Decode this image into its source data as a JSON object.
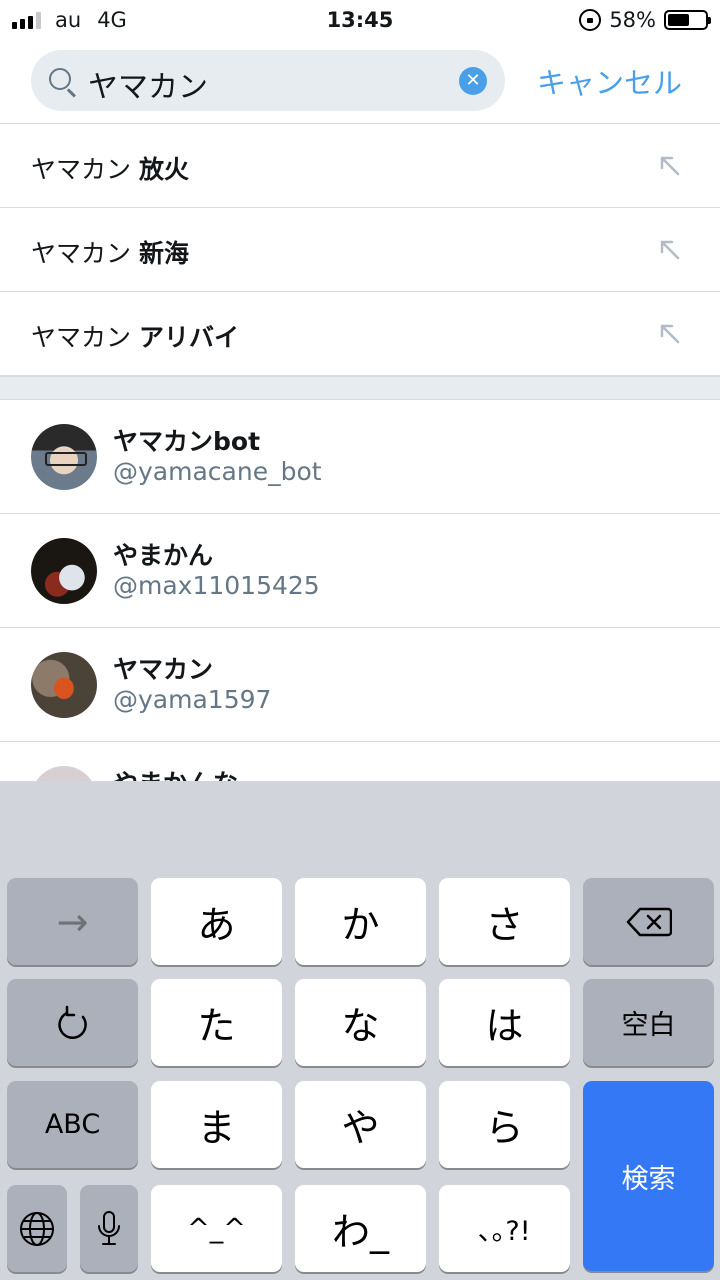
{
  "status_bar": {
    "carrier": "au",
    "network": "4G",
    "time": "13:45",
    "battery_percent": "58%",
    "battery_level": 0.58,
    "signal_bars": 3
  },
  "search": {
    "query": "ヤマカン",
    "cancel_label": "キャンセル",
    "clear_icon": "✕"
  },
  "suggestions": [
    {
      "prefix": "ヤマカン ",
      "suffix": "放火"
    },
    {
      "prefix": "ヤマカン ",
      "suffix": "新海"
    },
    {
      "prefix": "ヤマカン ",
      "suffix": "アリバイ"
    }
  ],
  "users": [
    {
      "name": "ヤマカンbot",
      "handle": "@yamacane_bot"
    },
    {
      "name": "やまかん",
      "handle": "@max11015425"
    },
    {
      "name": "ヤマカン",
      "handle": "@yama1597"
    },
    {
      "name": "やまかんな",
      "handle": ""
    }
  ],
  "keyboard": {
    "next_key": "→",
    "row1": [
      "あ",
      "か",
      "さ"
    ],
    "row2": [
      "た",
      "な",
      "は"
    ],
    "row3": [
      "ま",
      "や",
      "ら"
    ],
    "row4": [
      "^_^",
      "わ_",
      "､｡?!"
    ],
    "space_label": "空白",
    "abc_label": "ABC",
    "search_label": "検索",
    "icons": {
      "backspace": "backspace-icon",
      "undo": "undo-icon",
      "globe": "globe-icon",
      "mic": "microphone-icon"
    },
    "search_key_color": "#3478f6"
  },
  "colors": {
    "accent": "#4a9fe9",
    "secondary_text": "#657786",
    "divider": "#d7dbe0"
  }
}
